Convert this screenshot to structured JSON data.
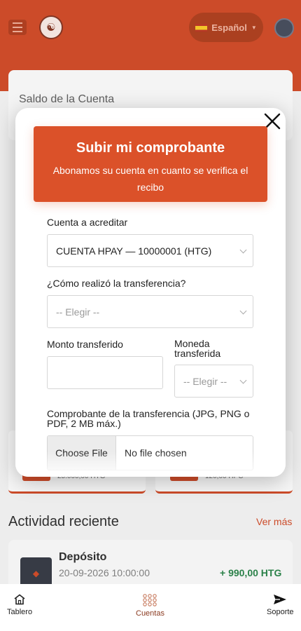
{
  "header": {
    "language_label": "Español",
    "language_flag": "spain-flag"
  },
  "account": {
    "balance_title": "Saldo de la Cuenta",
    "tiles": [
      {
        "amount": "25.000,00 HTG"
      },
      {
        "amount": "120,00 HPC"
      }
    ]
  },
  "recent": {
    "title": "Actividad reciente",
    "see_more": "Ver más",
    "items": [
      {
        "title": "Depósito",
        "date": "20-09-2026 10:00:00",
        "amount": "+ 990,00 HTG"
      }
    ]
  },
  "modal": {
    "close_icon": "close-icon",
    "title": "Subir mi comprobante",
    "subtitle": "Abonamos su cuenta en cuanto se verifica el recibo",
    "account_label": "Cuenta a acreditar",
    "account_value": "CUENTA HPAY — 10000001 (HTG)",
    "method_label": "¿Cómo realizó la transferencia?",
    "method_placeholder": "-- Elegir --",
    "amount_label": "Monto transferido",
    "amount_value": "",
    "currency_label": "Moneda transferida",
    "currency_placeholder": "-- Elegir --",
    "receipt_label": "Comprobante de la transferencia (JPG, PNG o PDF, 2 MB máx.)",
    "choose_file": "Choose File",
    "file_status": "No file chosen"
  },
  "nav": {
    "items": [
      {
        "label": "Tablero",
        "icon": "home-icon"
      },
      {
        "label": "Cuentas",
        "icon": "grid-icon"
      },
      {
        "label": "Soporte",
        "icon": "send-icon"
      }
    ]
  },
  "colors": {
    "brand": "#c9401c",
    "modal_header": "#db5129",
    "positive": "#1e7a3e"
  }
}
